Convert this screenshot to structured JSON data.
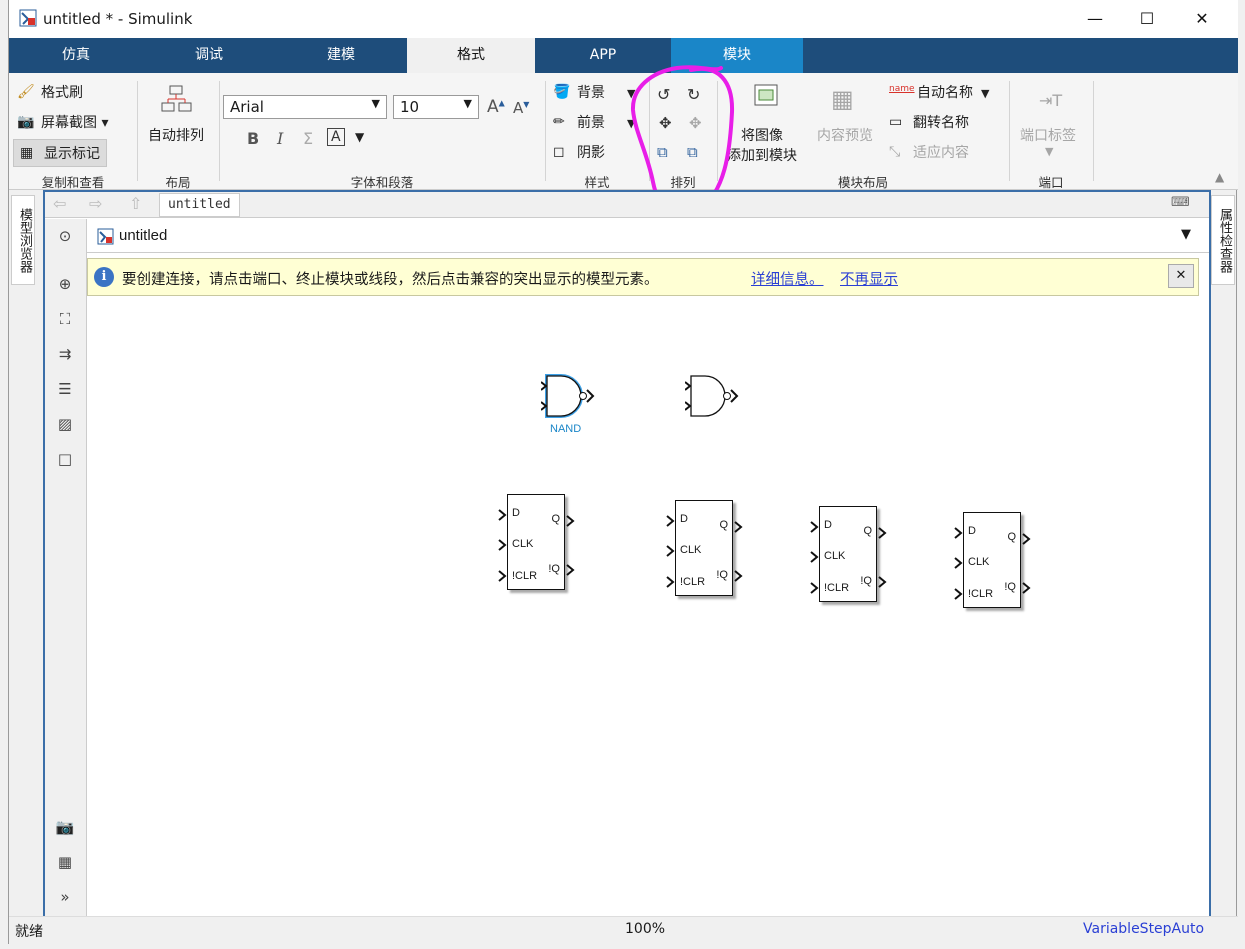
{
  "window": {
    "title": "untitled * - Simulink",
    "minimize": "—",
    "maximize": "☐",
    "close": "✕"
  },
  "tabs": [
    {
      "label": "仿真"
    },
    {
      "label": "调试"
    },
    {
      "label": "建模"
    },
    {
      "label": "格式"
    },
    {
      "label": "APP"
    },
    {
      "label": "模块"
    }
  ],
  "ribbon": {
    "copy_view": {
      "format_painter": "格式刷",
      "screenshot": "屏幕截图",
      "show_markup": "显示标记",
      "group": "复制和查看"
    },
    "layout": {
      "auto_arrange": "自动排列",
      "group": "布局"
    },
    "font": {
      "family": "Arial",
      "size": "10",
      "bold": "B",
      "italic": "I",
      "sigma": "Σ",
      "textbox": "A",
      "group": "字体和段落"
    },
    "style": {
      "background": "背景",
      "foreground": "前景",
      "shadow": "阴影",
      "group": "样式"
    },
    "arrange": {
      "group": "排列"
    },
    "block_layout": {
      "add_image_line1": "将图像",
      "add_image_line2": "添加到模块",
      "content_preview": "内容预览",
      "auto_name": "自动名称",
      "flip_name": "翻转名称",
      "fit_content": "适应内容",
      "group": "模块布局",
      "name_icon": "name"
    },
    "port": {
      "port_label": "端口标签",
      "group": "端口"
    }
  },
  "side": {
    "model_browser": "模型浏览器",
    "property_inspector": "属性检查器"
  },
  "nav": {
    "breadcrumb": "untitled"
  },
  "address": {
    "model": "untitled"
  },
  "info_bar": {
    "message": "要创建连接，请点击端口、终止模块或线段，然后点击兼容的突出显示的模型元素。",
    "more_info": "详细信息。",
    "dont_show": "不再显示"
  },
  "diagram": {
    "nand_label": "NAND",
    "flipflops": [
      {
        "d": "D",
        "q": "Q",
        "clk": "CLK",
        "nq": "!Q",
        "clr": "!CLR"
      },
      {
        "d": "D",
        "q": "Q",
        "clk": "CLK",
        "nq": "!Q",
        "clr": "!CLR"
      },
      {
        "d": "D",
        "q": "Q",
        "clk": "CLK",
        "nq": "!Q",
        "clr": "!CLR"
      },
      {
        "d": "D",
        "q": "Q",
        "clk": "CLK",
        "nq": "!Q",
        "clr": "!CLR"
      }
    ]
  },
  "status": {
    "ready": "就绪",
    "zoom": "100%",
    "solver": "VariableStepAuto"
  },
  "colors": {
    "tab_bar": "#1e4d7b",
    "module_tab": "#1a86c8",
    "selection": "#3da0e6",
    "annotation": "#e81ee8"
  }
}
